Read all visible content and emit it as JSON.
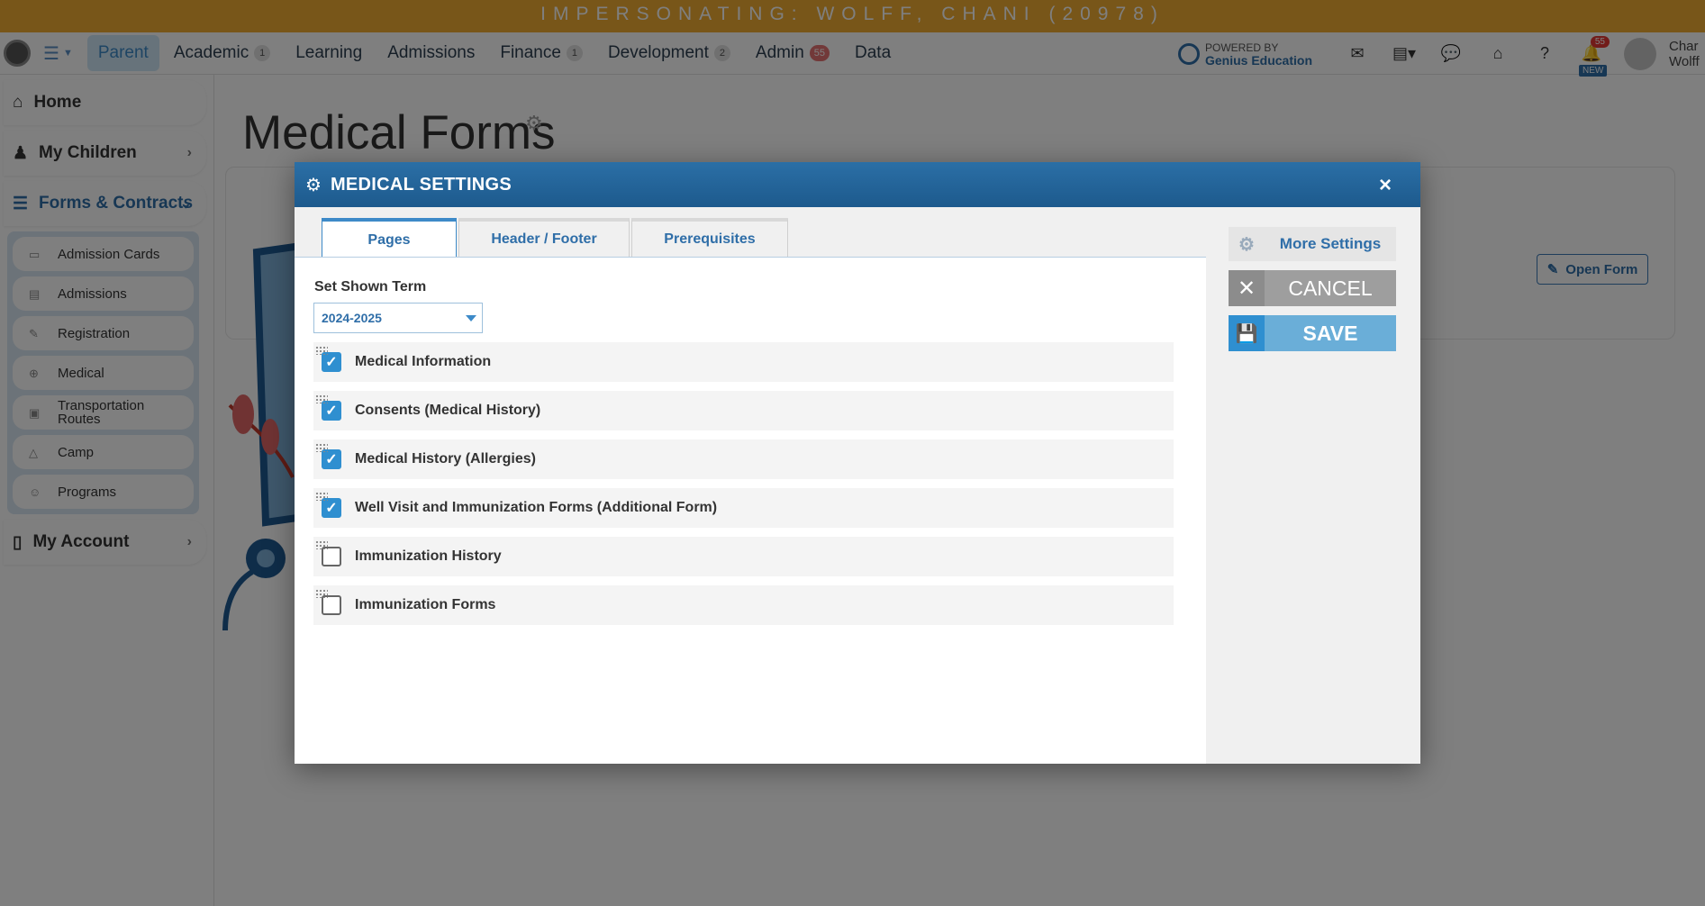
{
  "banner": {
    "text": "IMPERSONATING: WOLFF, CHANI (20978)"
  },
  "topnav": {
    "items": [
      {
        "label": "Parent",
        "badge": ""
      },
      {
        "label": "Academic",
        "badge": "1"
      },
      {
        "label": "Learning",
        "badge": ""
      },
      {
        "label": "Admissions",
        "badge": ""
      },
      {
        "label": "Finance",
        "badge": "1"
      },
      {
        "label": "Development",
        "badge": "2"
      },
      {
        "label": "Admin",
        "badge": "55"
      },
      {
        "label": "Data",
        "badge": ""
      }
    ],
    "powered_by": "POWERED BY",
    "powered_brand": "Genius Education",
    "bell_count": "55",
    "bell_new": "NEW",
    "user_first": "Char",
    "user_last": "Wolff"
  },
  "sidebar": {
    "home": "Home",
    "my_children": "My Children",
    "forms": "Forms & Contracts",
    "sub_items": [
      "Admission Cards",
      "Admissions",
      "Registration",
      "Medical",
      "Transportation Routes",
      "Camp",
      "Programs"
    ],
    "my_account": "My Account"
  },
  "page": {
    "title": "Medical Forms",
    "open_form": "Open Form"
  },
  "modal": {
    "title": "MEDICAL SETTINGS",
    "close": "×",
    "tabs": [
      "Pages",
      "Header / Footer",
      "Prerequisites"
    ],
    "term_label": "Set Shown Term",
    "term_value": "2024-2025",
    "pages": [
      {
        "label": "Medical Information",
        "checked": true
      },
      {
        "label": "Consents (Medical History)",
        "checked": true
      },
      {
        "label": "Medical History (Allergies)",
        "checked": true
      },
      {
        "label": "Well Visit and Immunization Forms (Additional Form)",
        "checked": true
      },
      {
        "label": "Immunization History",
        "checked": false
      },
      {
        "label": "Immunization Forms",
        "checked": false
      }
    ],
    "more_settings": "More Settings",
    "cancel": "CANCEL",
    "save": "SAVE"
  },
  "colors": {
    "banner": "#f0ad32",
    "modal_header": "#1d5a8d",
    "accent": "#2f8fd0",
    "save": "#6aaed8",
    "cancel": "#9e9e9e"
  }
}
